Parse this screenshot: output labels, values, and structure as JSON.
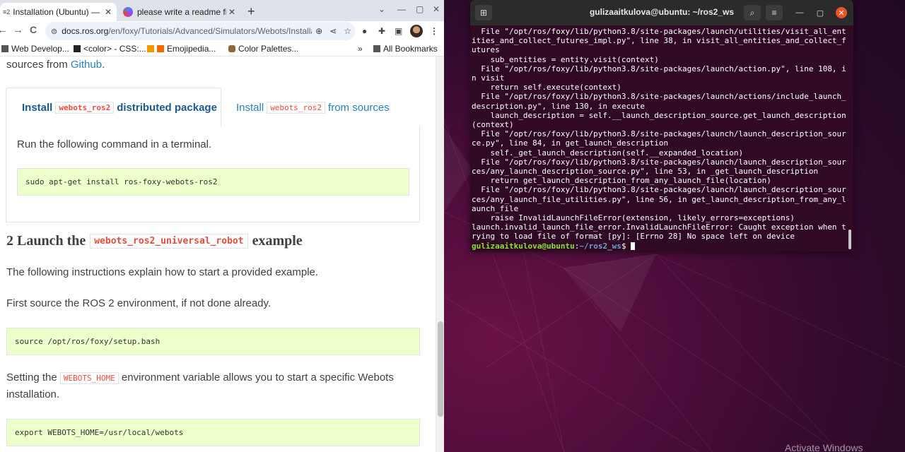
{
  "browser": {
    "tabs": [
      {
        "favicon": "≡2",
        "title": "Installation (Ubuntu) — R"
      },
      {
        "favicon": "",
        "title": "please write a readme file"
      }
    ],
    "new_tab": "+",
    "window_controls": [
      "⌄",
      "—",
      "▢",
      "✕"
    ],
    "nav": {
      "back": "←",
      "forward": "→",
      "reload": "C"
    },
    "url_host": "docs.ros.org",
    "url_path": "/en/foxy/Tutorials/Advanced/Simulators/Webots/Installati...",
    "bookmarks": [
      {
        "label": "Web Develop...",
        "color": "#4a4a4a"
      },
      {
        "label": "<color> - CSS:...",
        "color": "#2a2a2a"
      },
      {
        "label": "Emojipedia...",
        "color": "#f29900"
      },
      {
        "label": "Color Palettes...",
        "color": "#6b4a2a"
      }
    ],
    "bookmarks_overflow": "»",
    "all_bookmarks": "All Bookmarks"
  },
  "page": {
    "intro_tail_prefix": "sources from ",
    "intro_link": "Github",
    "intro_tail_suffix": ".",
    "tab_pkg": {
      "pre": "Install",
      "code": "webots_ros2",
      "post": "distributed package"
    },
    "tab_src": {
      "pre": "Install",
      "code": "webots_ros2",
      "post": "from sources"
    },
    "run_text": "Run the following command in a terminal.",
    "apt_cmd": "sudo apt-get install ros-foxy-webots-ros2",
    "section": {
      "num": "2 Launch the",
      "code": "webots_ros2_universal_robot",
      "post": "example"
    },
    "instructions": "The following instructions explain how to start a provided example.",
    "first_source": "First source the ROS 2 environment, if not done already.",
    "source_cmd": "source /opt/ros/foxy/setup.bash",
    "setting_pre": "Setting the",
    "setting_code": "WEBOTS_HOME",
    "setting_post": "environment variable allows you to start a specific Webots",
    "setting_line2": "installation.",
    "export_cmd": "export WEBOTS_HOME=/usr/local/webots"
  },
  "terminal": {
    "title": "gulizaaitkulova@ubuntu: ~/ros2_ws",
    "lines": [
      "  File \"/opt/ros/foxy/lib/python3.8/site-packages/launch/utilities/visit_all_ent",
      "ities_and_collect_futures_impl.py\", line 38, in visit_all_entities_and_collect_f",
      "utures",
      "    sub_entities = entity.visit(context)",
      "  File \"/opt/ros/foxy/lib/python3.8/site-packages/launch/action.py\", line 108, i",
      "n visit",
      "    return self.execute(context)",
      "  File \"/opt/ros/foxy/lib/python3.8/site-packages/launch/actions/include_launch_",
      "description.py\", line 130, in execute",
      "    launch_description = self.__launch_description_source.get_launch_description",
      "(context)",
      "  File \"/opt/ros/foxy/lib/python3.8/site-packages/launch/launch_description_sour",
      "ce.py\", line 84, in get_launch_description",
      "    self._get_launch_description(self.__expanded_location)",
      "  File \"/opt/ros/foxy/lib/python3.8/site-packages/launch/launch_description_sour",
      "ces/any_launch_description_source.py\", line 53, in _get_launch_description",
      "    return get_launch_description_from_any_launch_file(location)",
      "  File \"/opt/ros/foxy/lib/python3.8/site-packages/launch/launch_description_sour",
      "ces/any_launch_file_utilities.py\", line 56, in get_launch_description_from_any_l",
      "aunch_file",
      "    raise InvalidLaunchFileError(extension, likely_errors=exceptions)",
      "launch.invalid_launch_file_error.InvalidLaunchFileError: Caught exception when t",
      "rying to load file of format [py]: [Errno 28] No space left on device"
    ],
    "prompt_user": "gulizaaitkulova@ubuntu",
    "prompt_sep": ":",
    "prompt_path": "~/ros2_ws",
    "prompt_end": "$ "
  },
  "desktop": {
    "watermark": "Activate Windows"
  },
  "colors": {
    "terminal_bg": "#300a24",
    "ubuntu_orange": "#e95420",
    "code_bg": "#eeffcc",
    "link": "#2980b9"
  }
}
